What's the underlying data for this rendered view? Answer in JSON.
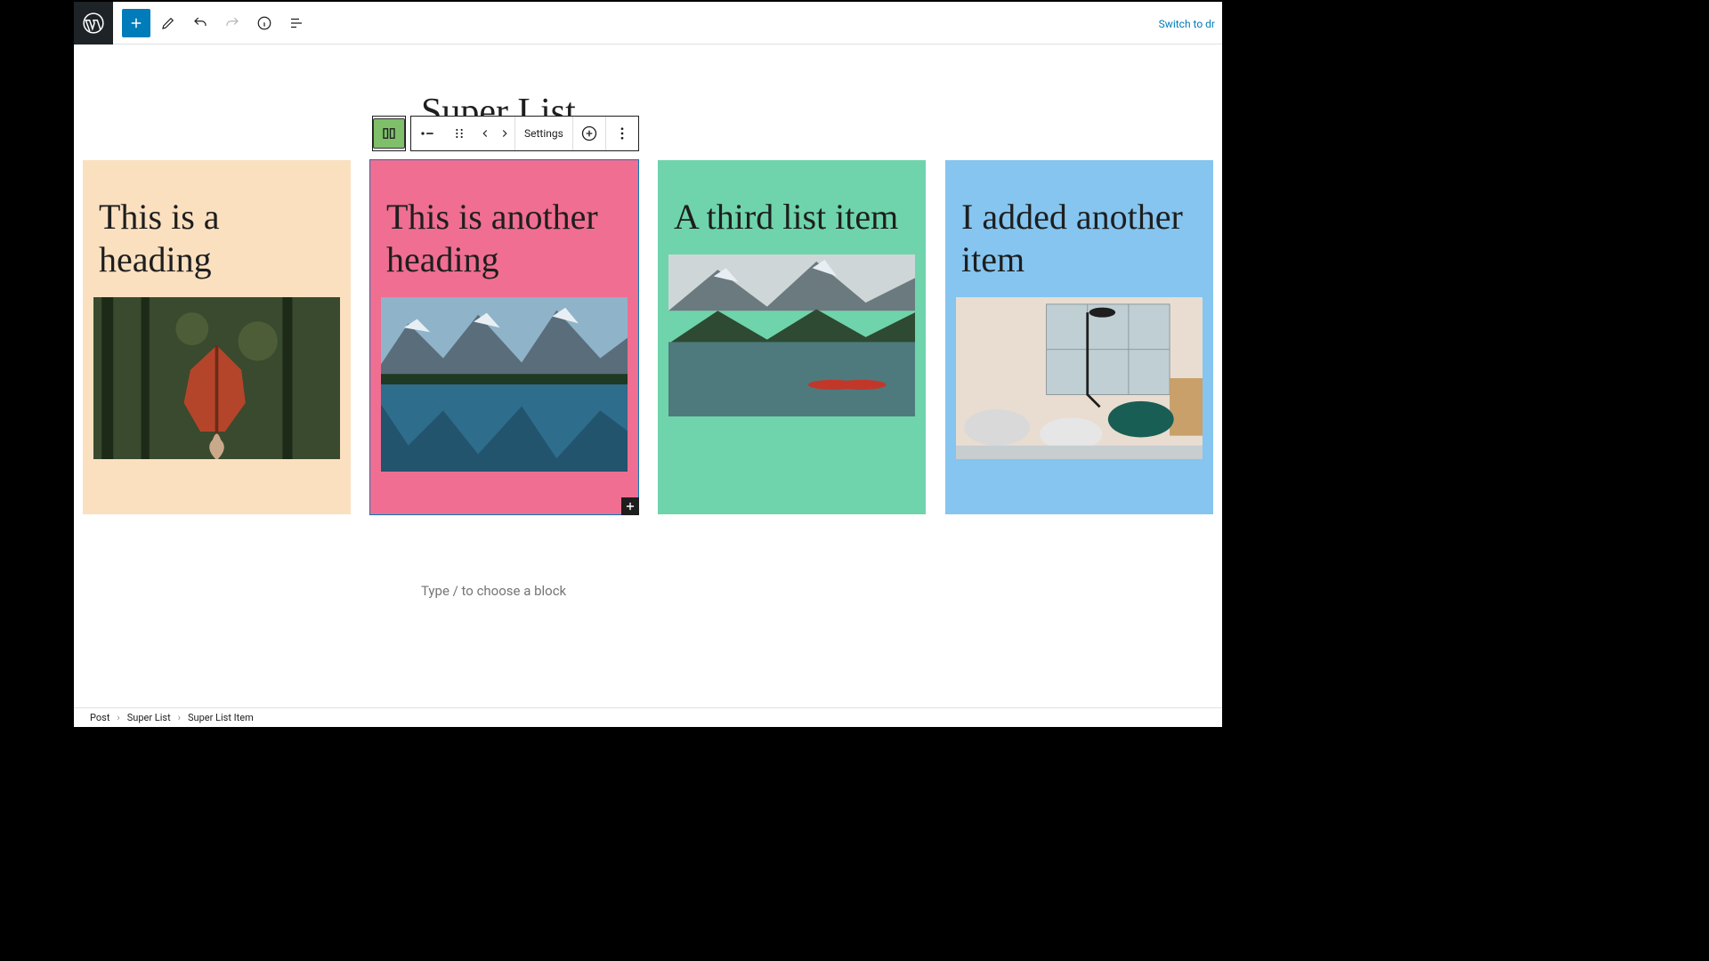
{
  "topbar": {
    "switch_link": "Switch to dr"
  },
  "post": {
    "title": "Super List",
    "placeholder_block_hint": "Type / to choose a block"
  },
  "block_toolbar": {
    "settings_label": "Settings"
  },
  "cards": [
    {
      "heading": "This is a heading",
      "bg": "#fbe0c0",
      "image_alt": "forest-leaf-photo"
    },
    {
      "heading": "This is another heading",
      "bg": "#ef6e91",
      "image_alt": "mountain-lake-photo",
      "selected": true
    },
    {
      "heading": "A third list item",
      "bg": "#6fd4ab",
      "image_alt": "lake-canoes-photo"
    },
    {
      "heading": "I added another item",
      "bg": "#85c5ef",
      "image_alt": "interior-room-photo"
    }
  ],
  "breadcrumb": {
    "items": [
      "Post",
      "Super List",
      "Super List Item"
    ]
  },
  "icons": {
    "wp_logo": "wordpress-logo-icon",
    "add_block": "plus-icon",
    "edit_tool": "pencil-icon",
    "undo": "undo-icon",
    "redo": "redo-icon",
    "info": "info-icon",
    "outline": "list-view-icon",
    "block_type": "superlist-block-icon",
    "list_style": "bullet-list-icon",
    "drag": "drag-handle-icon",
    "move_left": "chevron-left-icon",
    "move_right": "chevron-right-icon",
    "insert": "plus-circle-icon",
    "more": "kebab-icon",
    "add_corner": "plus-icon"
  }
}
